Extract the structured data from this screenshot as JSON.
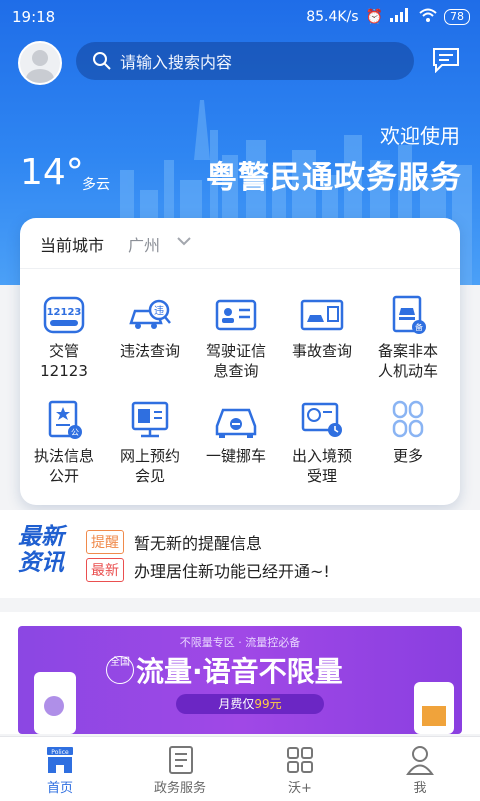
{
  "status": {
    "time": "19:18",
    "speed": "85.4K/s",
    "battery": "78"
  },
  "header": {
    "search_placeholder": "请输入搜索内容",
    "welcome": "欢迎使用",
    "service_title": "粤警民通政务服务",
    "temperature": "14°",
    "weather": "多云"
  },
  "city": {
    "label": "当前城市",
    "value": "广州"
  },
  "services": [
    {
      "label1": "交管",
      "label2": "12123",
      "icon": "traffic-12123-icon"
    },
    {
      "label1": "违法查询",
      "label2": "",
      "icon": "violation-car-icon"
    },
    {
      "label1": "驾驶证信",
      "label2": "息查询",
      "icon": "license-card-icon"
    },
    {
      "label1": "事故查询",
      "label2": "",
      "icon": "accident-icon"
    },
    {
      "label1": "备案非本",
      "label2": "人机动车",
      "icon": "vehicle-record-icon"
    },
    {
      "label1": "执法信息",
      "label2": "公开",
      "icon": "law-info-icon"
    },
    {
      "label1": "网上预约",
      "label2": "会见",
      "icon": "appointment-icon"
    },
    {
      "label1": "一键挪车",
      "label2": "",
      "icon": "move-car-icon"
    },
    {
      "label1": "出入境预",
      "label2": "受理",
      "icon": "exit-entry-icon"
    },
    {
      "label1": "更多",
      "label2": "",
      "icon": "more-grid-icon"
    }
  ],
  "news": {
    "logo_line1": "最新",
    "logo_line2": "资讯",
    "items": [
      {
        "tag": "提醒",
        "text": "暂无新的提醒信息"
      },
      {
        "tag": "最新",
        "text": "办理居住新功能已经开通~!"
      }
    ]
  },
  "banner": {
    "top_text": "不限量专区 · 流量控必备",
    "badge": "全国",
    "main_text": "流量·语音不限量",
    "price_prefix": "月费仅",
    "price_value": "99元"
  },
  "tabs": [
    {
      "label": "首页",
      "icon": "home-police-icon",
      "active": true,
      "badge": "Police"
    },
    {
      "label": "政务服务",
      "icon": "document-icon",
      "active": false
    },
    {
      "label": "沃+",
      "icon": "grid-icon",
      "active": false
    },
    {
      "label": "我",
      "icon": "person-icon",
      "active": false
    }
  ],
  "colors": {
    "primary": "#2f6fe0",
    "hero": "#2f86f2",
    "tag_orange": "#f08a4b",
    "tag_red": "#ea4f4f"
  }
}
